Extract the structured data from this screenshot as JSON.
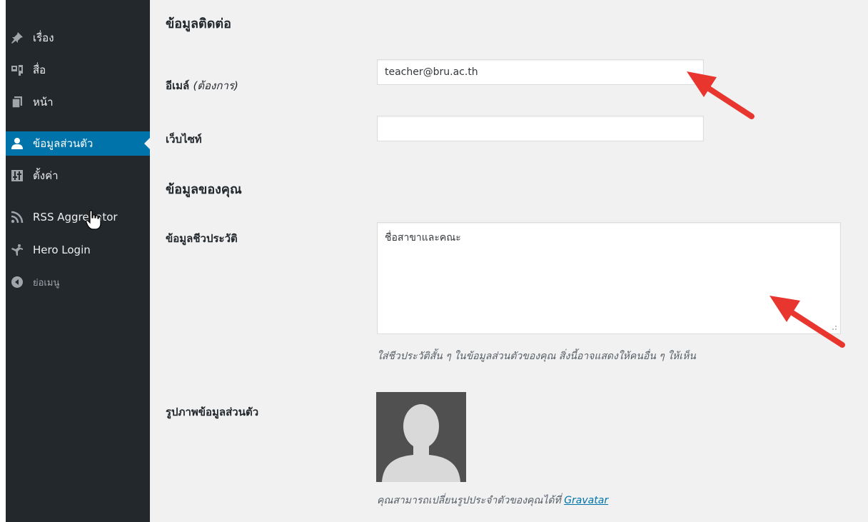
{
  "sidebar": {
    "items": [
      {
        "label": "เรื่อง",
        "icon": "pin-icon"
      },
      {
        "label": "สื่อ",
        "icon": "media-icon"
      },
      {
        "label": "หน้า",
        "icon": "page-icon"
      },
      {
        "label": "ข้อมูลส่วนตัว",
        "icon": "user-icon",
        "active": true
      },
      {
        "label": "ตั้งค่า",
        "icon": "settings-icon"
      },
      {
        "label": "RSS Aggregator",
        "icon": "rss-icon"
      },
      {
        "label": "Hero Login",
        "icon": "hero-icon"
      },
      {
        "label": "ย่อเมนู",
        "icon": "collapse-icon"
      }
    ]
  },
  "contact": {
    "heading": "ข้อมูลติดต่อ",
    "email_label": "อีเมล์",
    "email_required": "(ต้องการ)",
    "email_value": "teacher@bru.ac.th",
    "website_label": "เว็บไซท์",
    "website_value": ""
  },
  "about": {
    "heading": "ข้อมูลของคุณ",
    "bio_label": "ข้อมูลชีวประวัติ",
    "bio_value": "ชื่อสาขาและคณะ",
    "bio_desc": "ใส่ชีวประวัติสั้น ๆ ในข้อมูลส่วนตัวของคุณ สิ่งนี้อาจแสดงให้คนอื่น ๆ ให้เห็น",
    "picture_label": "รูปภาพข้อมูลส่วนตัว",
    "picture_desc": "คุณสามารถเปลี่ยนรูปประจำตัวของคุณได้ที่",
    "gravatar_link": "Gravatar"
  },
  "colors": {
    "sidebar_bg": "#23282d",
    "active_bg": "#0073aa",
    "content_bg": "#f1f1f1",
    "arrow": "#e8362f"
  }
}
